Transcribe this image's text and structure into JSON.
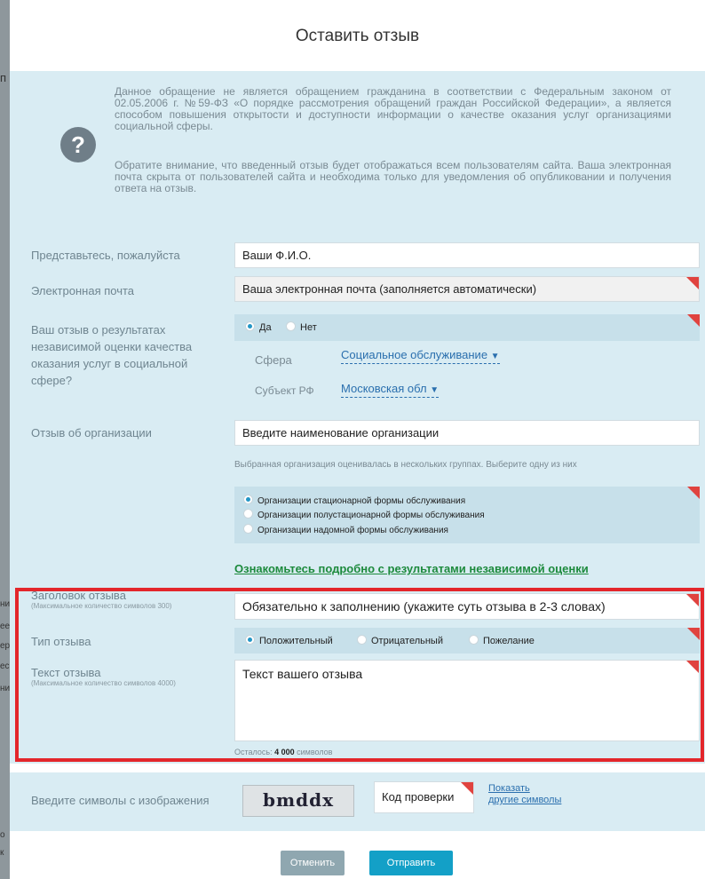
{
  "bg_fragments": [
    "п",
    "ни",
    "ее",
    "ер",
    "ес",
    "ни",
    "о",
    "к"
  ],
  "modal": {
    "title": "Оставить отзыв",
    "info_icon": "question-icon",
    "info_p1": "Данное обращение не является обращением гражданина в соответствии с Федеральным законом от 02.05.2006 г. №59-ФЗ «О порядке рассмотрения обращений граждан Российской Федерации», а является способом повышения открытости и доступности информации о качестве оказания услуг организациями социальной сферы.",
    "info_p2": "Обратите внимание, что введенный отзыв будет отображаться всем пользователям сайта. Ваша электронная почта скрыта от пользователей сайта и необходима только для уведомления об опубликовании и получения ответа на отзыв."
  },
  "form": {
    "name_label": "Представьтесь, пожалуйста",
    "name_value": "Ваши Ф.И.О.",
    "email_label": "Электронная почта",
    "email_value": "Ваша электронная почта (заполняется автоматически)",
    "eval_label": "Ваш отзыв о результатах независимой оценки качества оказания услуг в социальной сфере?",
    "eval_yes": "Да",
    "eval_no": "Нет",
    "sphere_label": "Сфера",
    "sphere_value": "Социальное обслуживание",
    "region_label": "Субъект РФ",
    "region_value": "Московская обл",
    "org_label": "Отзыв об организации",
    "org_value": "Введите наименование организации",
    "org_hint": "Выбранная организация оценивалась в нескольких группах. Выберите одну из них",
    "groups": [
      "Организации стационарной формы обслуживания",
      "Организации полустационарной формы обслуживания",
      "Организации надомной формы обслуживания"
    ],
    "results_link": "Ознакомьтесь подробно с результатами независимой оценки",
    "heading_label": "Заголовок отзыва",
    "heading_sub": "(Максимальное количество символов 300)",
    "heading_value": "Обязательно к заполнению  (укажите суть отзыва в 2-3 словах)",
    "type_label": "Тип отзыва",
    "types": [
      "Положительный",
      "Отрицательный",
      "Пожелание"
    ],
    "text_label": "Текст отзыва",
    "text_sub": "(Максимальное количество символов 4000)",
    "text_value": "Текст вашего отзыва",
    "remaining_prefix": "Осталось: ",
    "remaining_count": "4 000",
    "remaining_suffix": " символов"
  },
  "captcha": {
    "label": "Введите символы с изображения",
    "image_text": "bmddx",
    "input_value": "Код проверки",
    "refresh_line1": "Показать",
    "refresh_line2": "другие символы"
  },
  "buttons": {
    "cancel": "Отменить",
    "submit": "Отправить"
  },
  "colors": {
    "accent": "#2396c6",
    "required_marker": "#e0433f",
    "link_green": "#1c8a3c",
    "highlight": "#e3262b"
  }
}
